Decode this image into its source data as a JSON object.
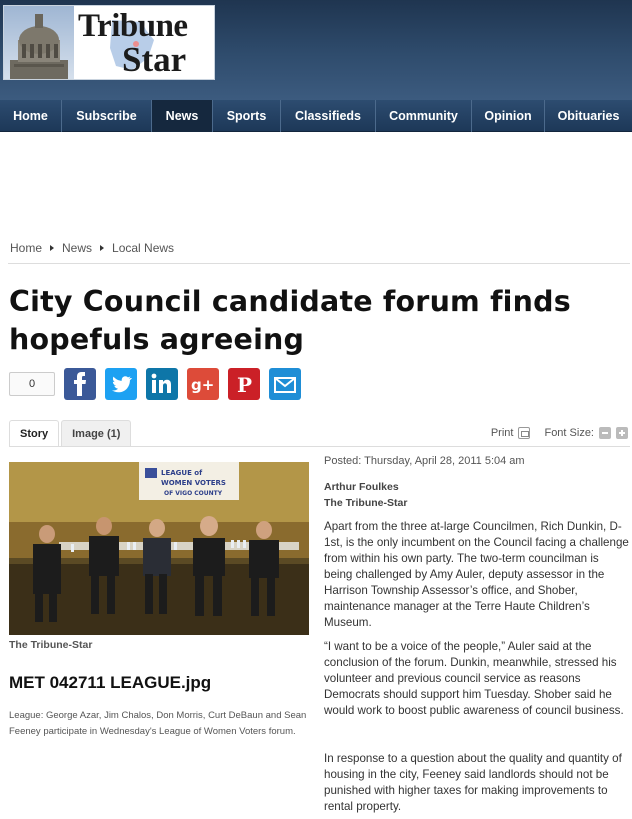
{
  "header": {
    "logo_word1": "Tribune",
    "logo_word2": "Star"
  },
  "nav": {
    "items": [
      {
        "label": "Home",
        "active": false
      },
      {
        "label": "Subscribe",
        "active": false
      },
      {
        "label": "News",
        "active": true
      },
      {
        "label": "Sports",
        "active": false
      },
      {
        "label": "Classifieds",
        "active": false
      },
      {
        "label": "Community",
        "active": false
      },
      {
        "label": "Opinion",
        "active": false
      },
      {
        "label": "Obituaries",
        "active": false
      }
    ]
  },
  "breadcrumb": [
    "Home",
    "News",
    "Local News"
  ],
  "article": {
    "headline": "City Council candidate forum finds hopefuls agreeing",
    "share_count": "0",
    "tabs": [
      "Story",
      "Image (1)"
    ],
    "print_label": "Print",
    "font_size_label": "Font Size:",
    "posted": "Posted: Thursday, April 28, 2011 5:04 am",
    "author": "Arthur Foulkes",
    "organization": "The Tribune-Star",
    "paragraphs": [
      "Apart from the three at-large Councilmen, Rich Dunkin, D-1st, is the only incumbent on the Council facing a challenge from within his own party. The two-term councilman is being challenged by Amy Auler, deputy assessor in the Harrison Township Assessor’s office, and Shober, maintenance manager at the Terre Haute Children’s Museum.",
      "“I want to be a voice of the people,” Auler said at the conclusion of the forum. Dunkin, meanwhile, stressed his volunteer and previous council service as reasons Democrats should support him Tuesday. Shober said he would work to boost public awareness of council business.",
      "In response to a question about the quality and quantity of housing in the city, Feeney said landlords should not be punished with higher taxes for making improvements to rental property."
    ]
  },
  "photo": {
    "banner_line1": "LEAGUE of",
    "banner_line2": "WOMEN VOTERS",
    "banner_line3": "OF VIGO COUNTY",
    "credit": "The Tribune-Star",
    "title": "MET 042711 LEAGUE.jpg",
    "caption": "League: George Azar, Jim Chalos, Don Morris, Curt DeBaun and Sean Feeney participate in Wednesday's League of Women Voters forum."
  },
  "share_icons": [
    {
      "name": "facebook",
      "color": "#3b5998"
    },
    {
      "name": "twitter",
      "color": "#1da1f2"
    },
    {
      "name": "linkedin",
      "color": "#0e76a8"
    },
    {
      "name": "google-plus",
      "color": "#dd4b39"
    },
    {
      "name": "pinterest",
      "color": "#cb2027"
    },
    {
      "name": "email",
      "color": "#1f8ed6"
    }
  ]
}
